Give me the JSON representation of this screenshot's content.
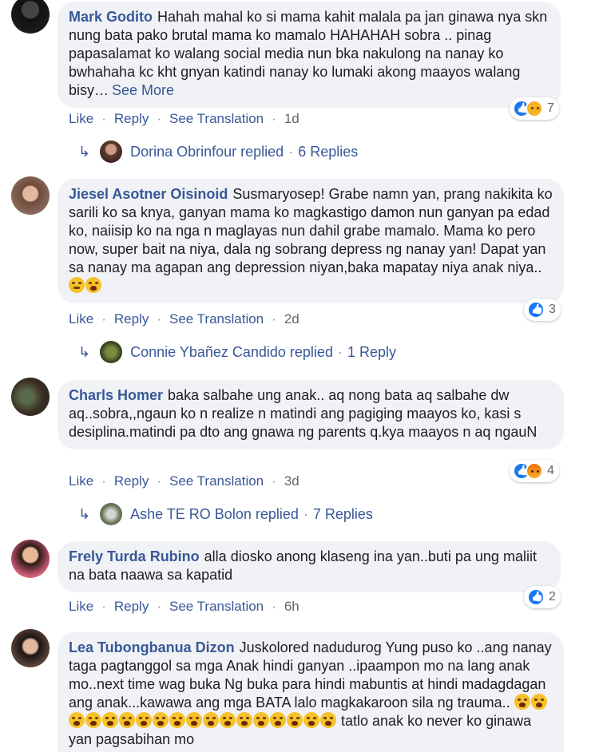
{
  "actions": {
    "like": "Like",
    "reply": "Reply",
    "translate": "See Translation",
    "sep": "·"
  },
  "comments": [
    {
      "author": "Mark Godito",
      "text": "Hahah mahal ko si mama kahit malala pa jan ginawa nya skn nung bata pako brutal mama ko mamalo HAHAHAH sobra .. pinag papasalamat ko walang social media nun bka nakulong na nanay ko bwhahaha kc kht gnyan katindi nanay ko lumaki akong maayos walang bisy…",
      "see_more": "See More",
      "time": "1d",
      "reaction_count": "7",
      "replier": "Dorina Obrinfour replied",
      "replies": "6 Replies"
    },
    {
      "author": "Jiesel Asotner Oisinoid",
      "text": "Susmaryosep! Grabe namn yan, prang nakikita ko sarili ko sa knya, ganyan mama ko magkastigo damon nun ganyan pa edad ko, naiisip ko na nga n maglayas nun dahil grabe mamalo. Mama ko pero now, super bait na niya, dala ng sobrang depress ng nanay yan! Dapat yan sa nanay ma agapan ang depression niyan,baka mapatay niya anak niya..",
      "time": "2d",
      "reaction_count": "3",
      "replier": "Connie Ybañez Candido replied",
      "replies": "1 Reply"
    },
    {
      "author": "Charls Homer",
      "text": "baka salbahe ung anak.. aq nong bata aq salbahe dw aq..sobra,,ngaun ko n realize n matindi ang pagiging maayos ko, kasi s desiplina.matindi pa dto ang gnawa ng parents q.kya maayos n aq ngauN",
      "time": "3d",
      "reaction_count": "4",
      "replier": "Ashe TE RO Bolon replied",
      "replies": "7 Replies"
    },
    {
      "author": "Frely Turda Rubino",
      "text": "alla diosko anong klaseng ina yan..buti pa ung maliit na bata naawa sa kapatid",
      "time": "6h",
      "reaction_count": "2"
    },
    {
      "author": "Lea Tubongbanua Dizon",
      "text": "Juskolored nadudurog Yung puso ko ..ang nanay taga pagtanggol sa mga Anak hindi ganyan ..ipaampon mo na lang anak mo..next time wag buka Ng buka para hindi mabuntis at hindi madagdagan ang anak...kawawa ang mga BATA lalo magkakaroon sila ng trauma..",
      "text_tail": "tatlo anak ko never ko ginawa yan pagsabihan mo"
    }
  ],
  "colors": {
    "link": "#385898",
    "bubble": "#f0f2f5",
    "like": "#1877f2"
  }
}
